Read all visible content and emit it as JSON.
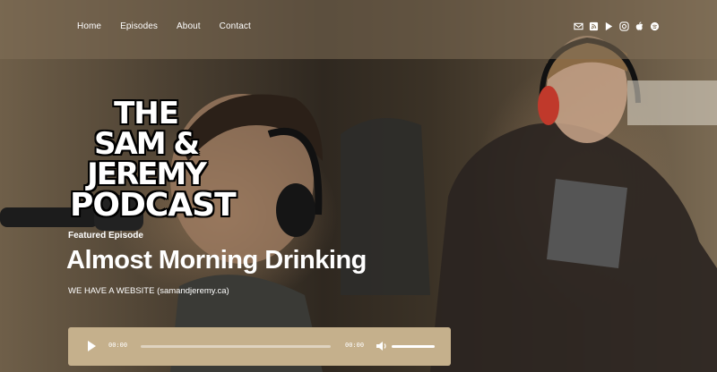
{
  "nav": {
    "items": [
      "Home",
      "Episodes",
      "About",
      "Contact"
    ]
  },
  "social": {
    "icons": [
      "mail-icon",
      "rss-icon",
      "google-play-icon",
      "instagram-icon",
      "apple-icon",
      "spotify-icon"
    ]
  },
  "logo": {
    "line1": "THE",
    "line2": "SAM & JEREMY",
    "line3": "PODCAST"
  },
  "featured": {
    "label": "Featured Episode",
    "title": "Almost Morning Drinking",
    "description": "WE HAVE A WEBSITE (samandjeremy.ca)"
  },
  "player": {
    "current_time": "00:00",
    "duration": "00:00",
    "progress": 0,
    "volume": 1
  }
}
